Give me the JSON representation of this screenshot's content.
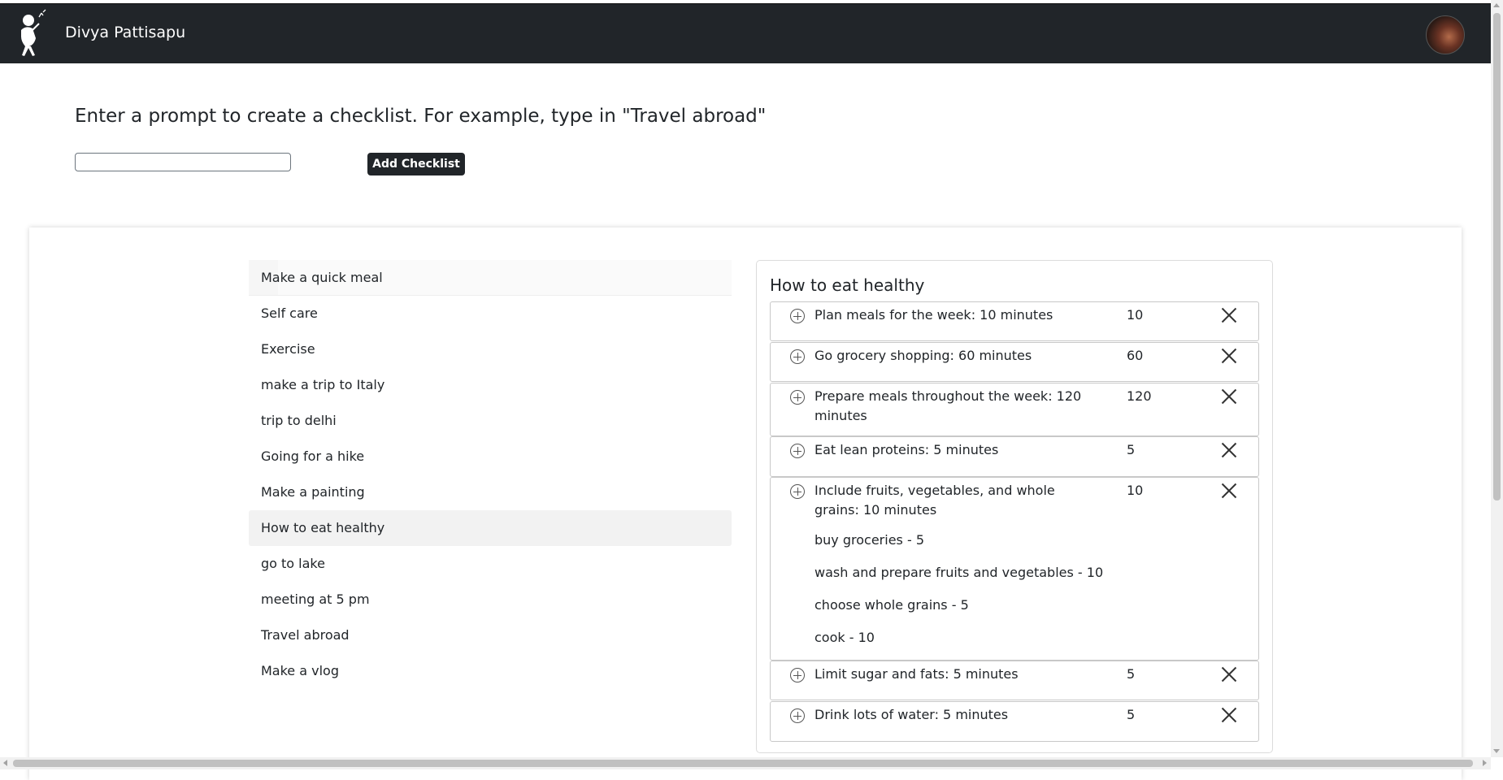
{
  "navbar": {
    "user_name": "Divya Pattisapu"
  },
  "prompt": {
    "title": "Enter a prompt to create a checklist. For example, type in \"Travel abroad\"",
    "input_value": "",
    "button_label": "Add Checklist"
  },
  "checklists": [
    {
      "label": "Make a quick meal"
    },
    {
      "label": "Self care"
    },
    {
      "label": "Exercise"
    },
    {
      "label": "make a trip to Italy"
    },
    {
      "label": "trip to delhi"
    },
    {
      "label": "Going for a hike"
    },
    {
      "label": "Make a painting"
    },
    {
      "label": "How to eat healthy"
    },
    {
      "label": "go to lake"
    },
    {
      "label": "meeting at 5 pm"
    },
    {
      "label": "Travel abroad"
    },
    {
      "label": "Make a vlog"
    }
  ],
  "detail": {
    "title": "How to eat healthy",
    "tasks": [
      {
        "text": "Plan meals for the week: 10 minutes",
        "minutes": "10"
      },
      {
        "text": "Go grocery shopping: 60 minutes",
        "minutes": "60"
      },
      {
        "text": "Prepare meals throughout the week: 120 minutes",
        "minutes": "120"
      },
      {
        "text": "Eat lean proteins: 5 minutes",
        "minutes": "5"
      },
      {
        "text": "Include fruits, vegetables, and whole grains: 10 minutes",
        "minutes": "10",
        "subtasks": [
          "buy groceries - 5",
          "wash and prepare fruits and vegetables - 10",
          "choose whole grains - 5",
          "cook - 10"
        ]
      },
      {
        "text": "Limit sugar and fats: 5 minutes",
        "minutes": "5"
      },
      {
        "text": "Drink lots of water: 5 minutes",
        "minutes": "5"
      }
    ]
  }
}
